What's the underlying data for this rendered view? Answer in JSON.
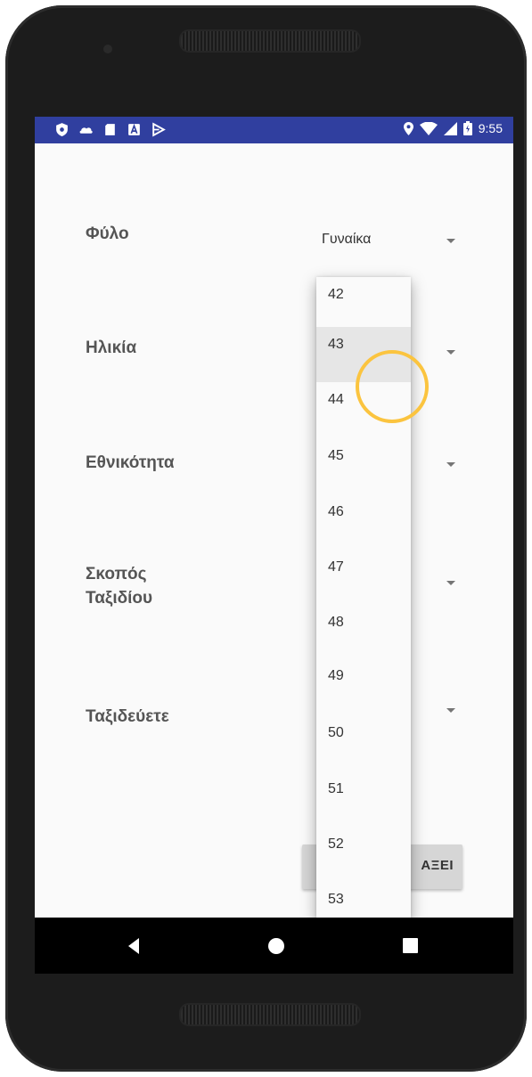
{
  "status_bar": {
    "time": "9:55",
    "left_icons": [
      "shield-icon",
      "cloud-icon",
      "sd-card-icon",
      "a-badge-icon",
      "play-store-icon"
    ],
    "right_icons": [
      "location-icon",
      "wifi-icon",
      "signal-icon",
      "battery-icon"
    ]
  },
  "form": {
    "fields": [
      {
        "label": "Φύλο",
        "value": "Γυναίκα"
      },
      {
        "label": "Ηλικία",
        "value": ""
      },
      {
        "label": "Εθνικότητα",
        "value": ""
      },
      {
        "label": "Σκοπός Ταξιδίου",
        "value": ""
      },
      {
        "label": "Ταξιδεύετε",
        "value": ""
      }
    ],
    "button_label": "ΑΞΕΙ"
  },
  "dropdown": {
    "selected": "43",
    "options": [
      "42",
      "43",
      "44",
      "45",
      "46",
      "47",
      "48",
      "49",
      "50",
      "51",
      "52",
      "53"
    ]
  },
  "nav_bar": {
    "buttons": [
      "back-icon",
      "home-icon",
      "recents-icon"
    ]
  },
  "colors": {
    "status_bar": "#303f9f",
    "touch_indicator": "#fbc43f",
    "background": "#fafafa"
  }
}
